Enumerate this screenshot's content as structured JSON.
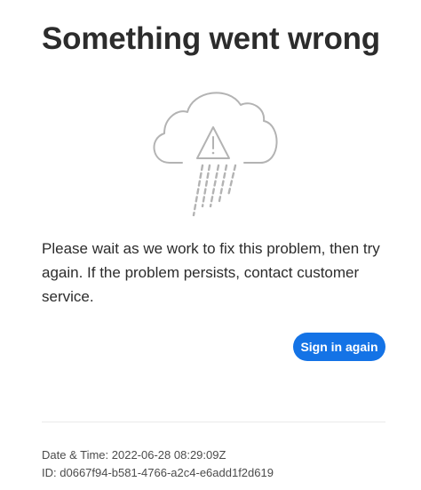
{
  "error": {
    "title": "Something went wrong",
    "illustration_icon": "cloud-warning-rain-icon",
    "message": "Please wait as we work to fix this problem, then try again. If the problem persists, contact customer service.",
    "signin_label": "Sign in again"
  },
  "meta": {
    "datetime_label": "Date & Time:",
    "datetime_value": "2022-06-28 08:29:09Z",
    "id_label": "ID:",
    "id_value": "d0667f94-b581-4766-a2c4-e6add1f2d619"
  },
  "colors": {
    "accent": "#1473e6",
    "text": "#2c2c2c",
    "illustration": "#b3b3b3"
  }
}
